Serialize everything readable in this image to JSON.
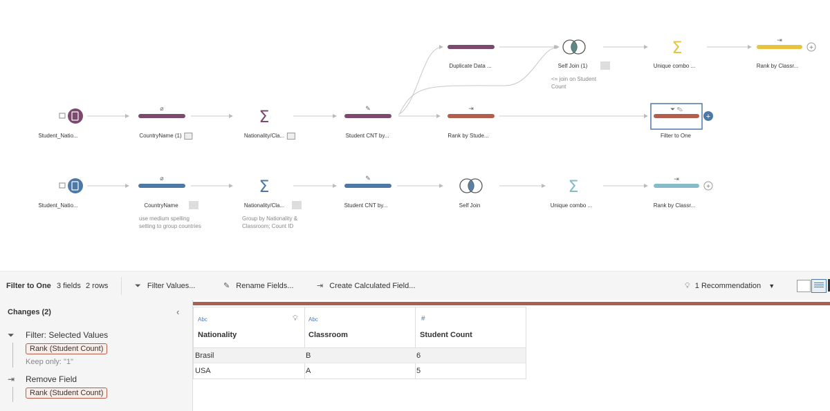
{
  "flow": {
    "row1": {
      "nodes": [
        {
          "label": "Student_Natio..."
        },
        {
          "label": "CountryName (1)"
        },
        {
          "label": "Nationality/Cla..."
        },
        {
          "label": "Student CNT by..."
        },
        {
          "label": "Rank by Stude..."
        },
        {
          "label": "Filter to One"
        }
      ]
    },
    "upper_branch": {
      "nodes": [
        {
          "label": "Duplicate Data ..."
        },
        {
          "label": "Self Join (1)",
          "note": "<= join on Student Count"
        },
        {
          "label": "Unique combo ..."
        },
        {
          "label": "Rank by Classr..."
        }
      ]
    },
    "row2": {
      "nodes": [
        {
          "label": "Student_Natio..."
        },
        {
          "label": "CountryName",
          "note": "use medium spelling setting to group countries"
        },
        {
          "label": "Nationality/Cla...",
          "note": "Group by Nationality & Classroom; Count ID"
        },
        {
          "label": "Student CNT by..."
        },
        {
          "label": "Self Join"
        },
        {
          "label": "Unique combo ..."
        },
        {
          "label": "Rank by Classr..."
        }
      ]
    },
    "colors": {
      "purple": "#7b4a6e",
      "rust": "#b35d4c",
      "blue": "#4e79a7",
      "gold": "#e6c440",
      "teal": "#86bcc9",
      "select": "#4e79a7"
    }
  },
  "toolbar": {
    "step_name": "Filter to One",
    "fields": "3 fields",
    "rows": "2 rows",
    "filter_values": "Filter Values...",
    "rename_fields": "Rename Fields...",
    "create_calc": "Create Calculated Field...",
    "recommendation": "1 Recommendation"
  },
  "changes": {
    "title": "Changes (2)",
    "items": [
      {
        "action": "Filter: Selected Values",
        "field": "Rank (Student Count)",
        "detail": "Keep only: \"1\""
      },
      {
        "action": "Remove Field",
        "field": "Rank (Student Count)"
      }
    ]
  },
  "table": {
    "columns": [
      {
        "type": "Abc",
        "name": "Nationality"
      },
      {
        "type": "Abc",
        "name": "Classroom"
      },
      {
        "type": "#",
        "name": "Student Count"
      }
    ],
    "rows": [
      [
        "Brasil",
        "B",
        "6"
      ],
      [
        "USA",
        "A",
        "5"
      ]
    ]
  }
}
